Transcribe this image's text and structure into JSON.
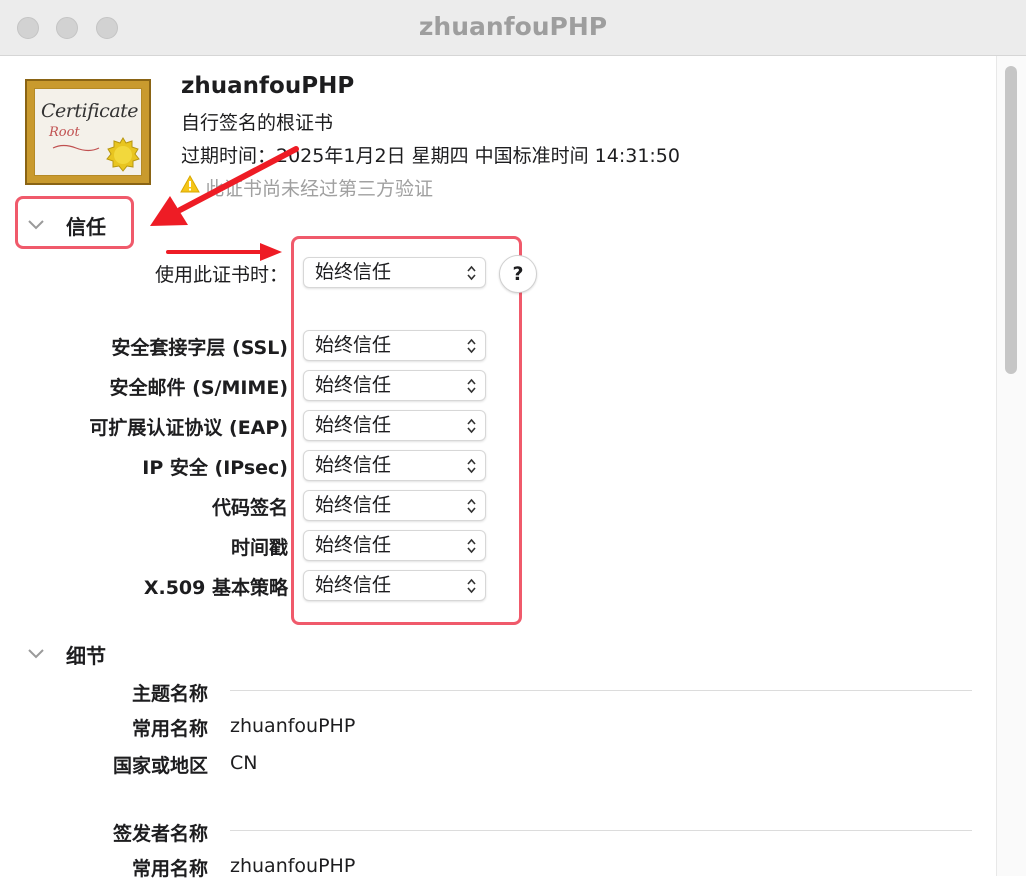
{
  "window": {
    "title": "zhuanfouPHP"
  },
  "certificate": {
    "icon_text": "Certificate",
    "icon_subtext": "Root",
    "name": "zhuanfouPHP",
    "type": "自行签名的根证书",
    "expiry": "过期时间：2025年1月2日 星期四 中国标准时间 14:31:50",
    "warning": "此证书尚未经过第三方验证"
  },
  "trust": {
    "section_title": "信任",
    "when_using_label": "使用此证书时：",
    "when_using_value": "始终信任",
    "help_label": "?",
    "rows": [
      {
        "label": "安全套接字层 (SSL)",
        "value": "始终信任"
      },
      {
        "label": "安全邮件 (S/MIME)",
        "value": "始终信任"
      },
      {
        "label": "可扩展认证协议 (EAP)",
        "value": "始终信任"
      },
      {
        "label": "IP 安全 (IPsec)",
        "value": "始终信任"
      },
      {
        "label": "代码签名",
        "value": "始终信任"
      },
      {
        "label": "时间戳",
        "value": "始终信任"
      },
      {
        "label": "X.509 基本策略",
        "value": "始终信任"
      }
    ]
  },
  "details": {
    "section_title": "细节",
    "subject": {
      "heading": "主题名称",
      "common_name_label": "常用名称",
      "common_name_value": "zhuanfouPHP",
      "country_label": "国家或地区",
      "country_value": "CN"
    },
    "issuer": {
      "heading": "签发者名称",
      "common_name_label": "常用名称",
      "common_name_value": "zhuanfouPHP"
    }
  },
  "colors": {
    "annotation": "#f05a6b",
    "arrow": "#ee1c25",
    "cert_gold": "#c99a2e"
  },
  "icons": {
    "close": "traffic-light-close",
    "minimize": "traffic-light-minimize",
    "zoom": "traffic-light-zoom",
    "warning": "warning-icon",
    "disclosure": "chevron-down-icon",
    "popup": "up-down-arrows-icon"
  }
}
